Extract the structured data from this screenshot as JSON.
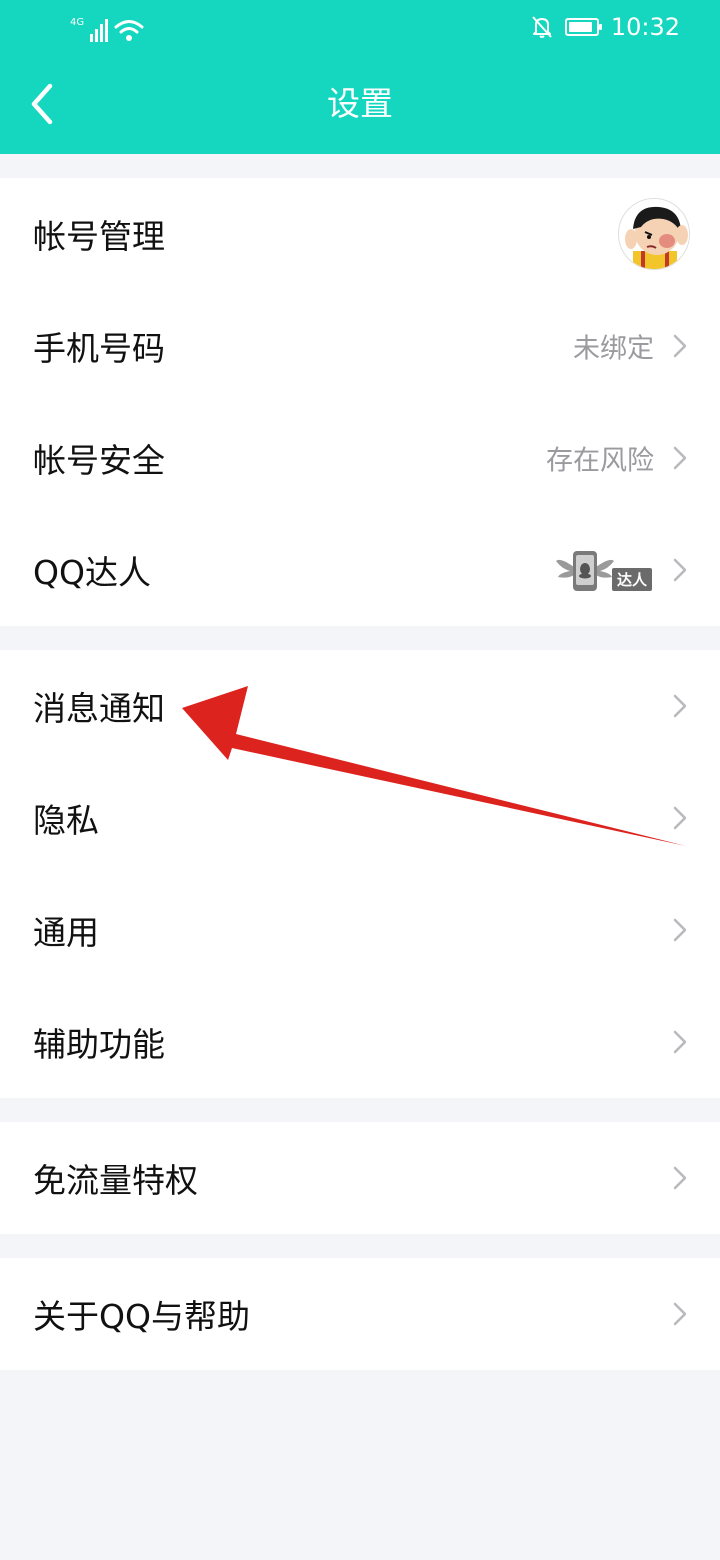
{
  "status_bar": {
    "network": "4G",
    "time": "10:32",
    "battery_level": 0.9,
    "icons": [
      "signal-icon",
      "wifi-icon",
      "bell-off-icon",
      "battery-icon"
    ]
  },
  "header": {
    "title": "设置",
    "back_icon": "back-chevron-icon",
    "background": "#15d6be"
  },
  "groups": [
    {
      "items": [
        {
          "label": "帐号管理",
          "value": "",
          "accessory": "avatar"
        },
        {
          "label": "手机号码",
          "value": "未绑定",
          "accessory": "chevron"
        },
        {
          "label": "帐号安全",
          "value": "存在风险",
          "accessory": "chevron"
        },
        {
          "label": "QQ达人",
          "value": "",
          "badge_text": "达人",
          "accessory": "badge"
        }
      ]
    },
    {
      "items": [
        {
          "label": "消息通知",
          "value": "",
          "accessory": "chevron"
        },
        {
          "label": "隐私",
          "value": "",
          "accessory": "chevron"
        },
        {
          "label": "通用",
          "value": "",
          "accessory": "chevron"
        },
        {
          "label": "辅助功能",
          "value": "",
          "accessory": "chevron"
        }
      ]
    },
    {
      "items": [
        {
          "label": "免流量特权",
          "value": "",
          "accessory": "chevron"
        }
      ]
    },
    {
      "items": [
        {
          "label": "关于QQ与帮助",
          "value": "",
          "accessory": "chevron"
        }
      ]
    }
  ],
  "annotation": {
    "type": "red-arrow",
    "points_to": "消息通知",
    "color": "#dc231e"
  }
}
